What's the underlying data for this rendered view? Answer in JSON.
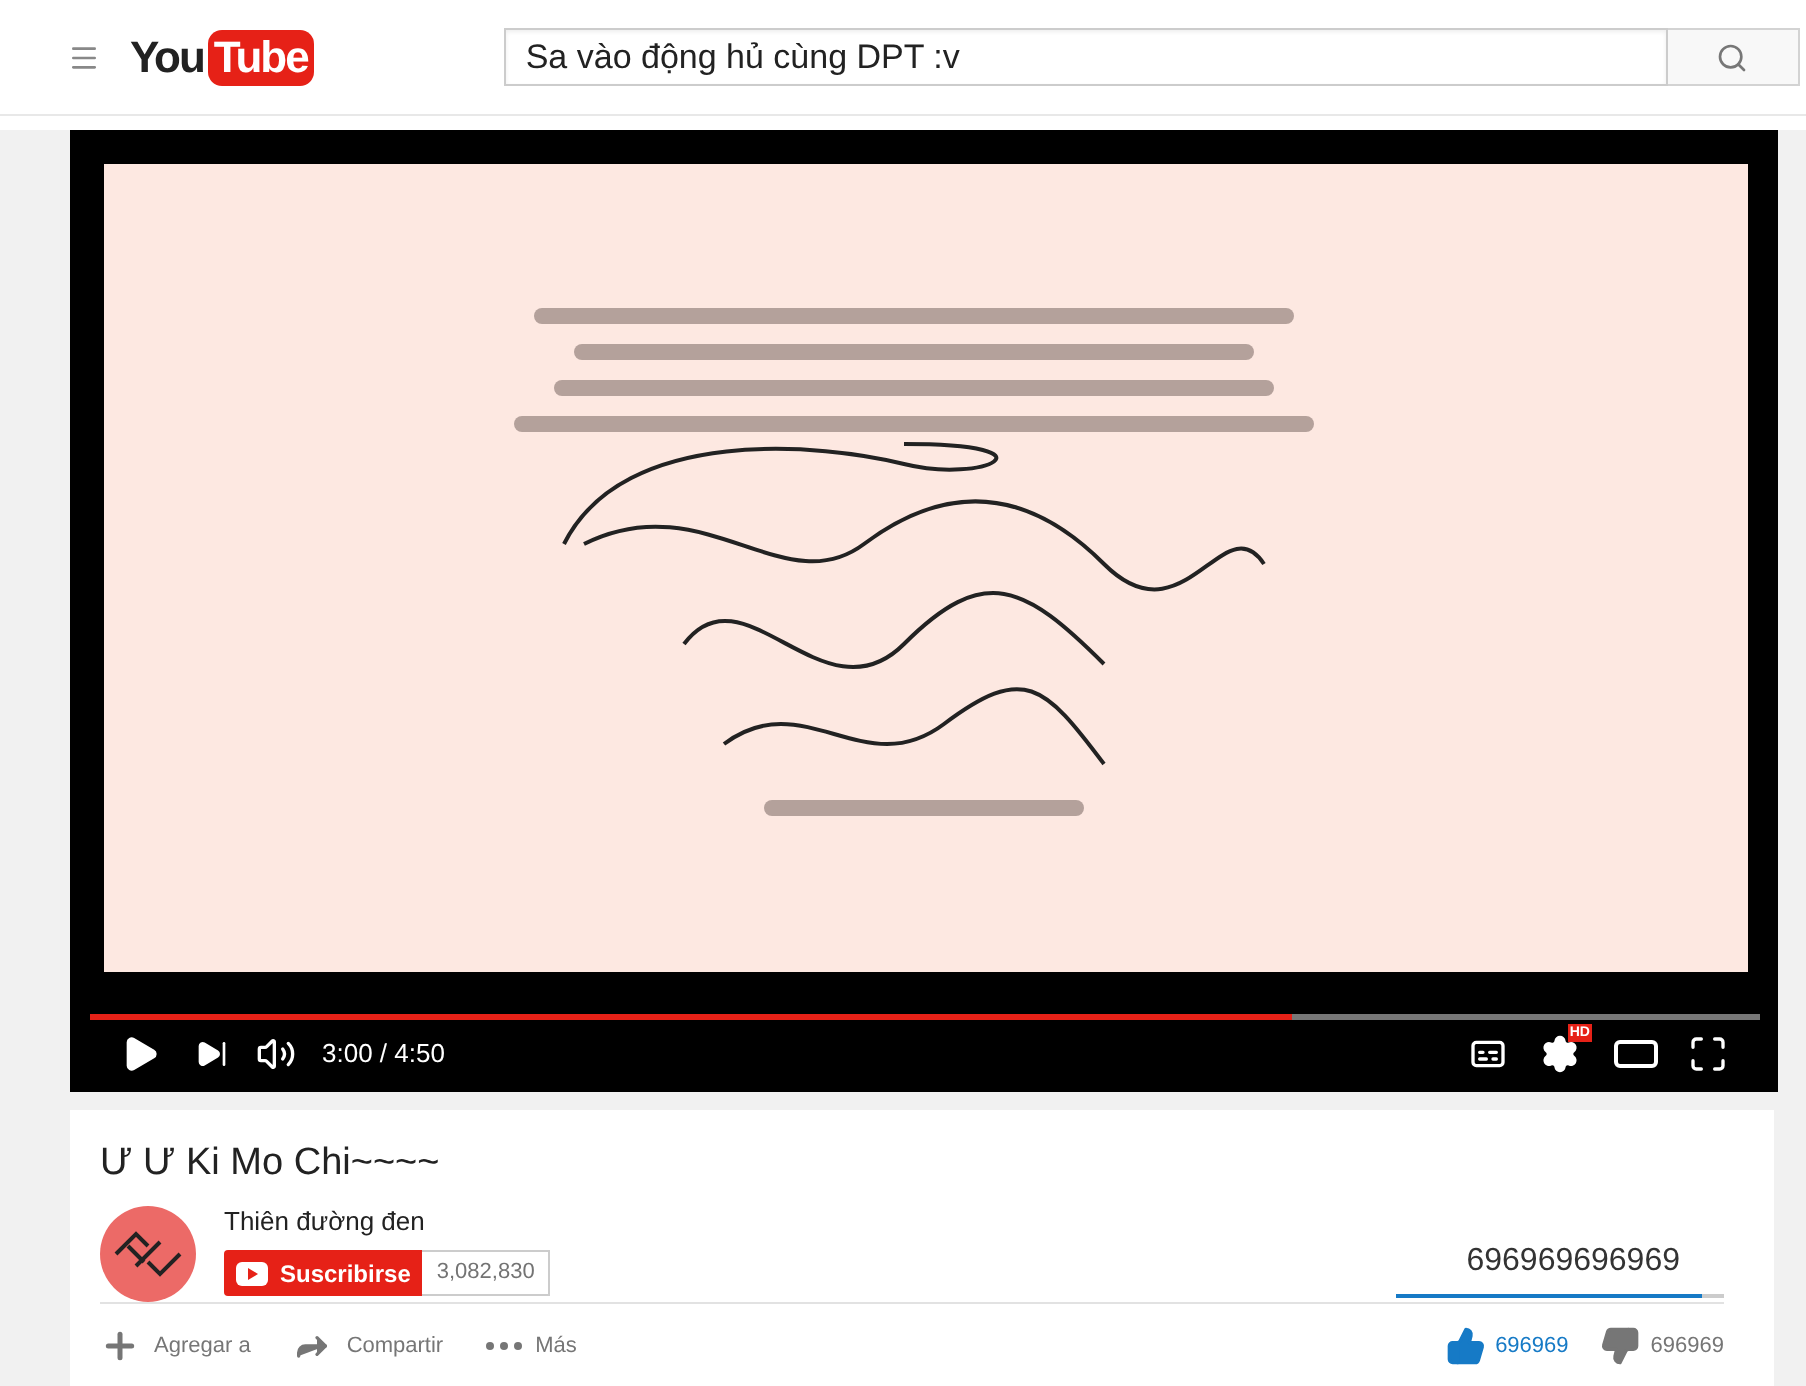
{
  "header": {
    "logo": {
      "left": "You",
      "right": "Tube"
    },
    "search": {
      "value": "Sa vào động hủ cùng DPT :v"
    }
  },
  "player": {
    "progress": {
      "level": 0.72
    },
    "time": "3:00 / 4:50",
    "hd_badge": "HD"
  },
  "video_info": {
    "title": "Ư Ư Ki Mo Chi~~~~",
    "channel": "Thiên đường đen",
    "subscribe": "Suscribirse",
    "subscriber_count": "3,082,830",
    "views": "696969696969",
    "sentiment": {
      "level": 0.93
    },
    "actions": [
      {
        "kind": "add",
        "label": "Agregar a"
      },
      {
        "kind": "share",
        "label": "Compartir"
      },
      {
        "kind": "more",
        "label": "Más"
      }
    ],
    "likes": "696969",
    "dislikes": "696969"
  }
}
